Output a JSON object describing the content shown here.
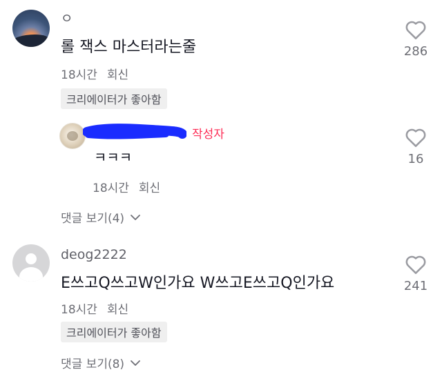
{
  "comments": [
    {
      "username": "ㅇ",
      "text": "롤 잭스 마스터라는줄",
      "time": "18시간",
      "reply_label": "회신",
      "creator_like": "크리에이터가 좋아함",
      "likes": "286",
      "view_replies": "댓글 보기(4)",
      "reply": {
        "author_tag": "작성자",
        "text": "ㅋㅋㅋ",
        "time": "18시간",
        "reply_label": "회신",
        "likes": "16"
      }
    },
    {
      "username": "deog2222",
      "text": "E쓰고Q쓰고W인가요 W쓰고E쓰고Q인가요",
      "time": "18시간",
      "reply_label": "회신",
      "creator_like": "크리에이터가 좋아함",
      "likes": "241",
      "view_replies": "댓글 보기(8)"
    }
  ],
  "colors": {
    "author_tag": "#fe2c55",
    "redaction": "#1a2cff",
    "text_secondary": "#6d6e75"
  },
  "icons": {
    "like": "heart-outline-icon",
    "expand": "chevron-down-icon"
  }
}
